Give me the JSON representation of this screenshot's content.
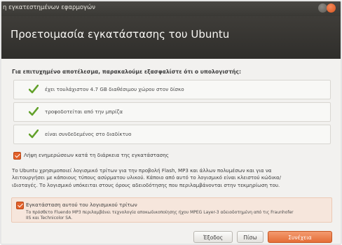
{
  "window": {
    "title": "η εγκατεστημένων εφαρμογών"
  },
  "header": {
    "title": "Προετοιμασία εγκατάστασης του Ubuntu"
  },
  "intro": "Για επιτυχημένο αποτέλεσμα, παρακαλούμε εξασφαλίστε ότι ο υπολογιστής:",
  "requirements": [
    {
      "label": "έχει τουλάχιστον 4.7 GB διαθέσιμου χώρου στον δίσκο",
      "icon": "checkmark-icon"
    },
    {
      "label": "τροφοδοτείται από την μπρίζα",
      "icon": "checkmark-icon"
    },
    {
      "label": "είναι συνδεδεμένος στο διαδίκτυο",
      "icon": "checkmark-icon"
    }
  ],
  "download_updates": {
    "label": "Λήψη ενημερώσεων κατά τη διάρκεια της εγκατάστασης",
    "checked": true
  },
  "info_lines": [
    "Το Ubuntu χρησιμοποιεί λογισμικό τρίτων για την προβολή Flash, MP3 και άλλων πολυμέσων και για να",
    "λειτουργήσει με κάποιους τύπους ασύρματου υλικού. Κάποιο από αυτό το λογισμικό είναι κλειστού κώδικα/",
    "ιδιοταγές. Το λογισμικό υπόκειται στους όρους αδειοδότησης που περιλαμβάνονται στην τεκμηρίωση του."
  ],
  "third_party": {
    "label": "Εγκατάσταση αυτού του λογισμικού τρίτων",
    "checked": true,
    "desc_lines": [
      "Το πρόσθετο Fluendo MP3 περιλαμβάνει τεχνολογία αποκωδικοποίησης ήχου MPEG Layer-3 αδειοδοτημένη από τις Fraunhofer",
      "IIS και Technicolor SA."
    ]
  },
  "buttons": {
    "quit": "Έξοδος",
    "back": "Πίσω",
    "continue": "Συνέχεια"
  },
  "colors": {
    "accent": "#e56d36",
    "header_bg": "#3a3935",
    "check_green": "#62a12a"
  }
}
